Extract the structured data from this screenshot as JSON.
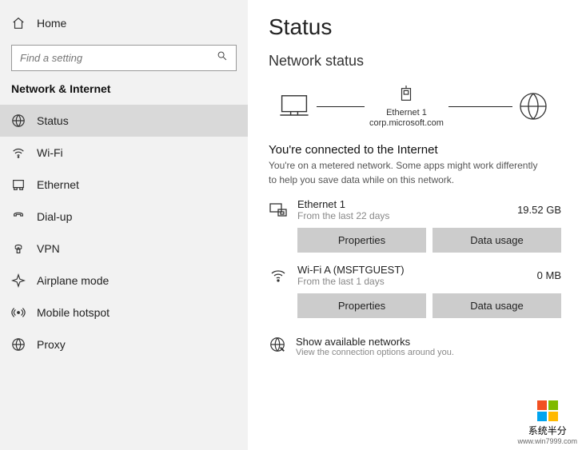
{
  "sidebar": {
    "home": "Home",
    "search_placeholder": "Find a setting",
    "section": "Network & Internet",
    "items": [
      {
        "label": "Status",
        "icon": "status-icon",
        "selected": true
      },
      {
        "label": "Wi-Fi",
        "icon": "wifi-icon",
        "selected": false
      },
      {
        "label": "Ethernet",
        "icon": "ethernet-icon",
        "selected": false
      },
      {
        "label": "Dial-up",
        "icon": "dialup-icon",
        "selected": false
      },
      {
        "label": "VPN",
        "icon": "vpn-icon",
        "selected": false
      },
      {
        "label": "Airplane mode",
        "icon": "airplane-icon",
        "selected": false
      },
      {
        "label": "Mobile hotspot",
        "icon": "hotspot-icon",
        "selected": false
      },
      {
        "label": "Proxy",
        "icon": "proxy-icon",
        "selected": false
      }
    ]
  },
  "main": {
    "title": "Status",
    "subheading": "Network status",
    "diagram": {
      "adapter_name": "Ethernet 1",
      "adapter_domain": "corp.microsoft.com"
    },
    "connected_heading": "You're connected to the Internet",
    "connected_desc": "You're on a metered network. Some apps might work differently to help you save data while on this network.",
    "connections": [
      {
        "icon": "ethernet-adapter-icon",
        "name": "Ethernet 1",
        "sub": "From the last 22 days",
        "usage": "19.52 GB",
        "properties_label": "Properties",
        "usage_label": "Data usage"
      },
      {
        "icon": "wifi-adapter-icon",
        "name": "Wi-Fi A (MSFTGUEST)",
        "sub": "From the last 1 days",
        "usage": "0 MB",
        "properties_label": "Properties",
        "usage_label": "Data usage"
      }
    ],
    "show_networks": {
      "title": "Show available networks",
      "sub": "View the connection options around you."
    }
  },
  "watermark": {
    "line1": "系统半分",
    "line2": "www.win7999.com"
  }
}
